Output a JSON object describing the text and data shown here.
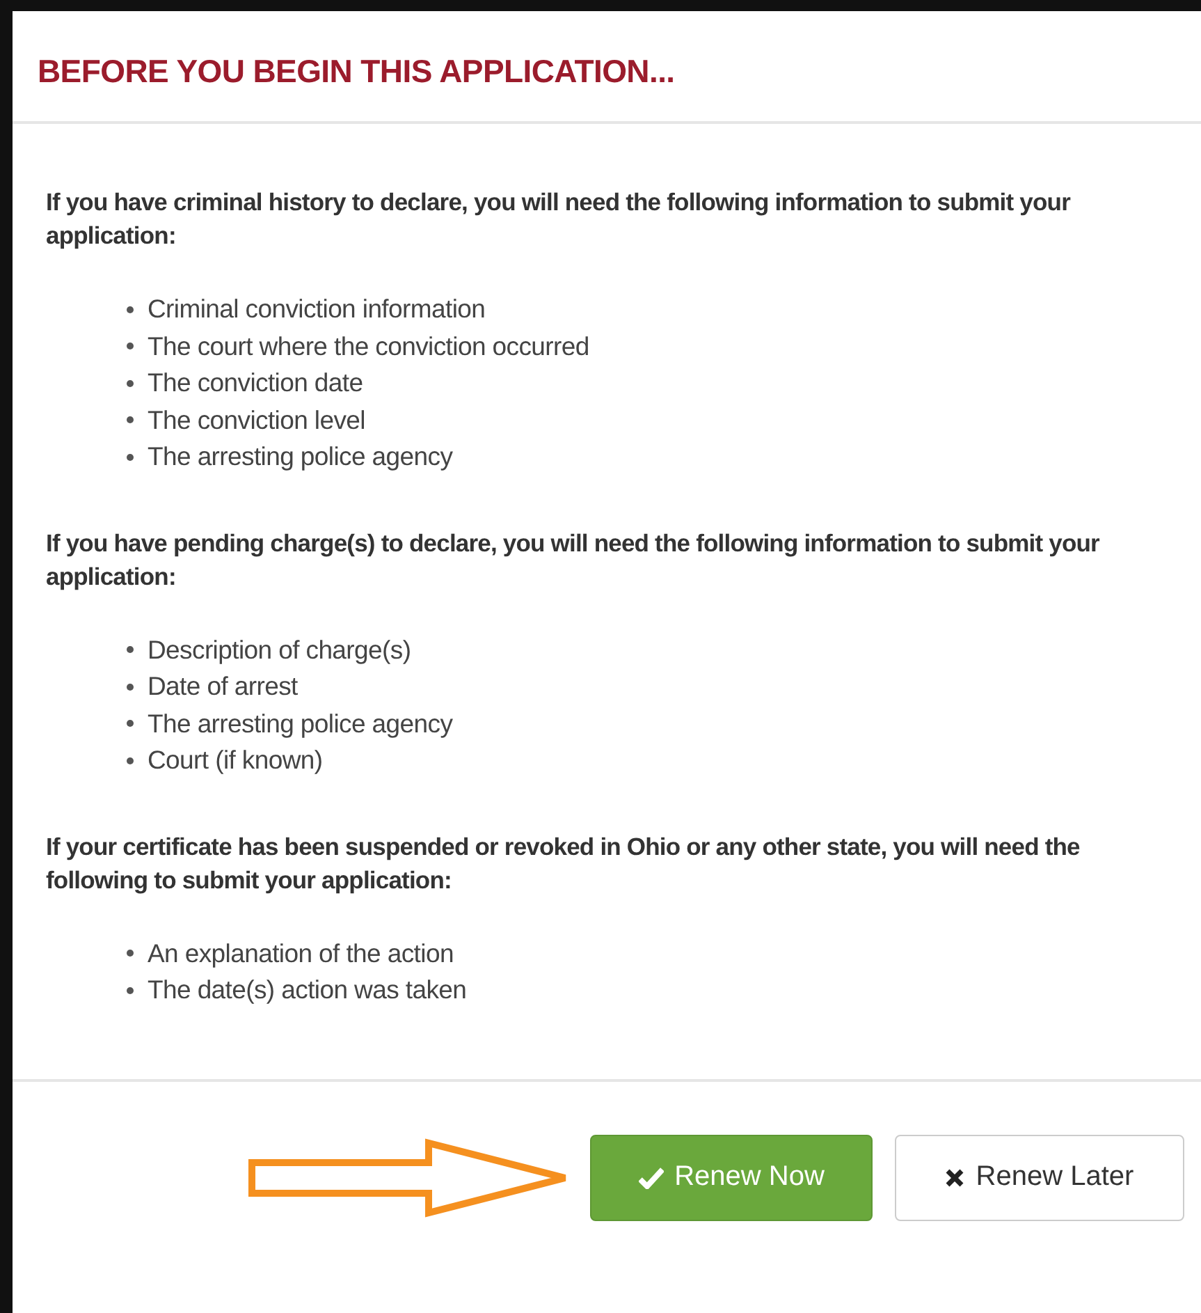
{
  "dialog": {
    "title": "BEFORE YOU BEGIN THIS APPLICATION..."
  },
  "sections": [
    {
      "intro": "If you have criminal history to declare, you will need the following information to submit your application:",
      "items": [
        "Criminal conviction information",
        "The court where the conviction occurred",
        "The conviction date",
        "The conviction level",
        "The arresting police agency"
      ]
    },
    {
      "intro": "If you have pending charge(s) to declare, you will need the following information to submit your application:",
      "items": [
        "Description of charge(s)",
        "Date of arrest",
        "The arresting police agency",
        "Court (if known)"
      ]
    },
    {
      "intro": "If your certificate has been suspended or revoked in Ohio or any other state, you will need the following to submit your application:",
      "items": [
        "An explanation of the action",
        "The date(s) action was taken"
      ]
    }
  ],
  "buttons": [
    {
      "label": "Renew Now",
      "kind": "primary"
    },
    {
      "label": "Renew Later",
      "kind": "secondary"
    }
  ]
}
